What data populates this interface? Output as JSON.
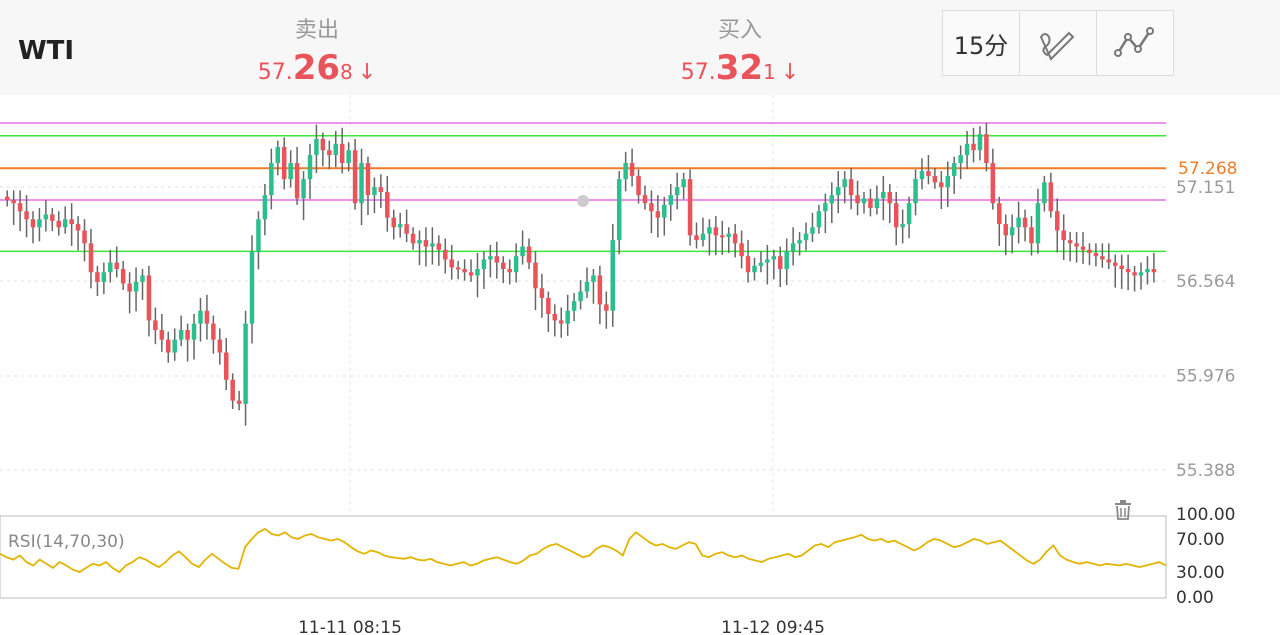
{
  "header": {
    "symbol": "WTI",
    "sell": {
      "label": "卖出",
      "price_small": "57.",
      "price_big": "26",
      "price_last": "8",
      "arrow": "↓"
    },
    "buy": {
      "label": "买入",
      "price_small": "57.",
      "price_big": "32",
      "price_last": "1",
      "arrow": "↓"
    },
    "tools": {
      "interval": "15分",
      "draw_icon": "pen-draw-icon",
      "indicator_icon": "line-indicator-icon"
    }
  },
  "colors": {
    "up": "#2bbf8e",
    "down": "#e8545a",
    "rsi": "#e2b400",
    "sell_line": "#f07c28",
    "green_line": "#39e639",
    "magenta_line": "#e070e8"
  },
  "chart_data": {
    "type": "candlestick",
    "price_axis": {
      "ticks": [
        "57.151",
        "56.564",
        "55.976",
        "55.388"
      ],
      "current_price": "57.268"
    },
    "time_axis": {
      "ticks": [
        "11-11 08:15",
        "11-12 09:45"
      ]
    },
    "horizontal_lines": [
      {
        "kind": "magenta",
        "value": 57.55
      },
      {
        "kind": "green",
        "value": 57.47
      },
      {
        "kind": "orange",
        "value": 57.268
      },
      {
        "kind": "magenta",
        "value": 57.07
      },
      {
        "kind": "green",
        "value": 56.75
      }
    ],
    "close_series": [
      57.07,
      57.05,
      57.0,
      56.95,
      56.9,
      56.95,
      56.98,
      56.94,
      56.9,
      56.95,
      56.92,
      56.88,
      56.8,
      56.62,
      56.56,
      56.62,
      56.68,
      56.64,
      56.55,
      56.5,
      56.56,
      56.6,
      56.32,
      56.26,
      56.2,
      56.12,
      56.2,
      56.26,
      56.2,
      56.3,
      56.38,
      56.3,
      56.2,
      56.12,
      55.95,
      55.82,
      55.8,
      56.3,
      56.75,
      56.95,
      57.1,
      57.3,
      57.4,
      57.2,
      57.3,
      57.08,
      57.2,
      57.35,
      57.45,
      57.38,
      57.35,
      57.42,
      57.3,
      57.38,
      57.05,
      57.3,
      57.1,
      57.15,
      57.12,
      56.96,
      56.9,
      56.92,
      56.86,
      56.8,
      56.82,
      56.78,
      56.8,
      56.76,
      56.7,
      56.65,
      56.64,
      56.62,
      56.6,
      56.64,
      56.7,
      56.72,
      56.68,
      56.64,
      56.62,
      56.72,
      56.78,
      56.68,
      56.52,
      56.46,
      56.36,
      56.32,
      56.3,
      56.38,
      56.44,
      56.5,
      56.56,
      56.6,
      56.42,
      56.38,
      56.82,
      57.2,
      57.3,
      57.22,
      57.1,
      57.05,
      57.0,
      56.96,
      57.04,
      57.1,
      57.15,
      57.2,
      56.85,
      56.82,
      56.86,
      56.9,
      56.85,
      56.84,
      56.86,
      56.8,
      56.72,
      56.62,
      56.66,
      56.68,
      56.7,
      56.72,
      56.64,
      56.75,
      56.8,
      56.82,
      56.86,
      56.9,
      57.0,
      57.05,
      57.1,
      57.15,
      57.2,
      57.1,
      57.05,
      57.08,
      57.02,
      57.08,
      57.12,
      57.05,
      56.9,
      56.92,
      57.05,
      57.2,
      57.25,
      57.22,
      57.18,
      57.15,
      57.22,
      57.3,
      57.35,
      57.42,
      57.38,
      57.48,
      57.3,
      57.05,
      56.92,
      56.85,
      56.9,
      56.96,
      56.9,
      56.8,
      57.05,
      57.18,
      57.0,
      56.88,
      56.82,
      56.8,
      56.78,
      56.76,
      56.74,
      56.72,
      56.7,
      56.68,
      56.66,
      56.64,
      56.62,
      56.6,
      56.62,
      56.64,
      56.62
    ],
    "rsi": {
      "label": "RSI(14,70,30)",
      "ticks": [
        "100.00",
        "70.00",
        "30.00",
        "0.00"
      ],
      "series": [
        52,
        48,
        45,
        50,
        42,
        38,
        45,
        40,
        35,
        42,
        38,
        33,
        30,
        35,
        40,
        38,
        42,
        35,
        30,
        38,
        42,
        48,
        45,
        40,
        36,
        42,
        50,
        55,
        48,
        40,
        36,
        45,
        52,
        46,
        40,
        35,
        34,
        60,
        70,
        78,
        82,
        76,
        74,
        78,
        72,
        70,
        74,
        76,
        72,
        70,
        68,
        70,
        66,
        60,
        55,
        52,
        56,
        54,
        50,
        48,
        47,
        46,
        48,
        45,
        44,
        46,
        42,
        40,
        38,
        40,
        42,
        38,
        40,
        44,
        46,
        48,
        45,
        42,
        40,
        44,
        50,
        52,
        58,
        62,
        64,
        60,
        56,
        52,
        48,
        50,
        58,
        62,
        60,
        56,
        50,
        70,
        78,
        72,
        66,
        62,
        64,
        60,
        58,
        62,
        66,
        64,
        50,
        48,
        52,
        54,
        50,
        48,
        50,
        46,
        44,
        42,
        46,
        48,
        50,
        52,
        48,
        50,
        56,
        62,
        64,
        60,
        66,
        68,
        70,
        72,
        75,
        70,
        68,
        70,
        66,
        68,
        64,
        60,
        56,
        60,
        66,
        70,
        68,
        64,
        60,
        62,
        66,
        70,
        68,
        64,
        66,
        68,
        62,
        56,
        50,
        44,
        40,
        45,
        55,
        62,
        50,
        45,
        42,
        40,
        42,
        40,
        38,
        40,
        39,
        38,
        40,
        38,
        36,
        38,
        40,
        42,
        38
      ]
    }
  }
}
